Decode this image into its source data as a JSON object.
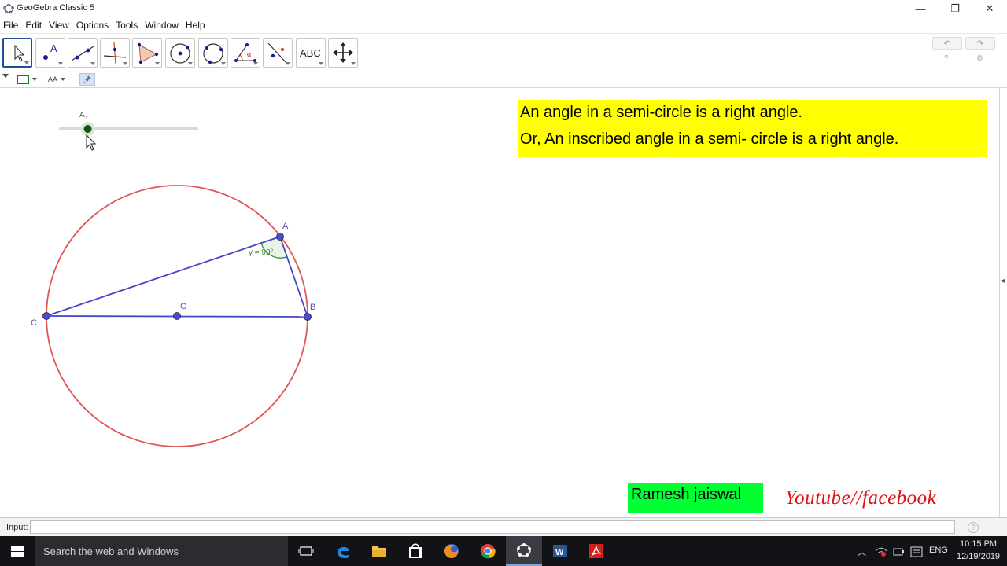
{
  "window": {
    "title": "GeoGebra Classic 5",
    "controls": {
      "minimize": "—",
      "restore": "❐",
      "close": "✕"
    }
  },
  "menu": [
    "File",
    "Edit",
    "View",
    "Options",
    "Tools",
    "Window",
    "Help"
  ],
  "toolbar": {
    "tools": [
      {
        "icon": "move-arrow-icon",
        "label": ""
      },
      {
        "icon": "point-icon",
        "label": "A"
      },
      {
        "icon": "line-icon",
        "label": ""
      },
      {
        "icon": "perpendicular-line-icon",
        "label": ""
      },
      {
        "icon": "polygon-icon",
        "label": ""
      },
      {
        "icon": "circle-center-point-icon",
        "label": ""
      },
      {
        "icon": "circle-three-points-icon",
        "label": ""
      },
      {
        "icon": "angle-icon",
        "label": "α"
      },
      {
        "icon": "reflect-icon",
        "label": ""
      },
      {
        "icon": "text-tool-icon",
        "label": "ABC"
      },
      {
        "icon": "move-graphics-icon",
        "label": ""
      }
    ],
    "undo_glyph": "↶",
    "redo_glyph": "↷",
    "help_glyph": "?",
    "settings_glyph": "⚙"
  },
  "stylebar": {
    "font_size_label": "AA"
  },
  "graphics": {
    "slider_label": "A",
    "slider_subscript": "1",
    "slider_value": 0.2,
    "points": {
      "A": "A",
      "B": "B",
      "C": "C",
      "O": "O"
    },
    "angle_label": "γ = 90°",
    "note": {
      "line1": "An angle in a semi-circle is a right angle.",
      "line2": "Or, An inscribed angle in a semi- circle is a right angle."
    },
    "signature": "Ramesh jaiswal",
    "channel": "Youtube//facebook"
  },
  "input": {
    "label": "Input:",
    "value": "",
    "help": "?"
  },
  "taskbar": {
    "search_placeholder": "Search the web and Windows",
    "language": "ENG",
    "time": "10:15 PM",
    "date": "12/19/2019"
  },
  "colors": {
    "circle": "#e05555",
    "segments": "#4545c8",
    "point_fill": "#4a4ae0",
    "angle": "#2e8b2e",
    "note_bg": "#ffff00",
    "signature_bg": "#00ff33",
    "channel_text": "#e01010"
  }
}
